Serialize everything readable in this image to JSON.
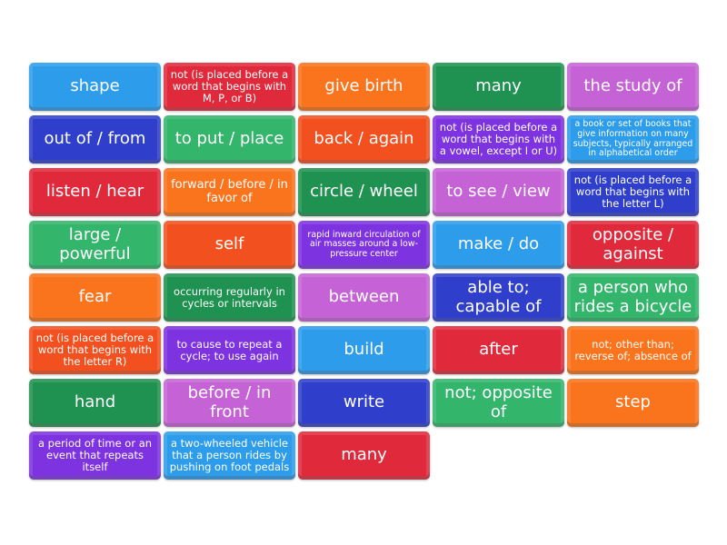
{
  "colors": {
    "blue": "#2d9ceb",
    "red": "#e02a3c",
    "orange": "#f9741c",
    "green": "#1f9150",
    "lightgreen": "#33b56c",
    "pink": "#c563d6",
    "darkblue": "#2f3fcc",
    "purple": "#7e33e0",
    "orangered": "#f2501f"
  },
  "tiles": [
    {
      "text": "shape",
      "color": "blue",
      "size": "l"
    },
    {
      "text": "not (is placed before a word that begins with M, P, or B)",
      "color": "red",
      "size": "s"
    },
    {
      "text": "give birth",
      "color": "orange",
      "size": "l"
    },
    {
      "text": "many",
      "color": "green",
      "size": "l"
    },
    {
      "text": "the study of",
      "color": "pink",
      "size": "l"
    },
    {
      "text": "out of / from",
      "color": "darkblue",
      "size": "l"
    },
    {
      "text": "to put / place",
      "color": "lightgreen",
      "size": "l"
    },
    {
      "text": "back / again",
      "color": "orangered",
      "size": "l"
    },
    {
      "text": "not (is placed before a word that begins with a vowel, except I or U)",
      "color": "purple",
      "size": "s"
    },
    {
      "text": "a book or set of books that give information on many subjects, typically arranged in alphabetical order",
      "color": "blue",
      "size": "xs"
    },
    {
      "text": "listen / hear",
      "color": "red",
      "size": "l"
    },
    {
      "text": "forward / before / in favor of",
      "color": "orange",
      "size": "m"
    },
    {
      "text": "circle / wheel",
      "color": "green",
      "size": "l"
    },
    {
      "text": "to see / view",
      "color": "pink",
      "size": "l"
    },
    {
      "text": "not (is placed before a word that begins with the letter L)",
      "color": "darkblue",
      "size": "s"
    },
    {
      "text": "large / powerful",
      "color": "lightgreen",
      "size": "l"
    },
    {
      "text": "self",
      "color": "orangered",
      "size": "l"
    },
    {
      "text": "rapid inward circulation of air masses around a low-pressure center",
      "color": "purple",
      "size": "xs"
    },
    {
      "text": "make / do",
      "color": "blue",
      "size": "l"
    },
    {
      "text": "opposite / against",
      "color": "red",
      "size": "l"
    },
    {
      "text": "fear",
      "color": "orange",
      "size": "l"
    },
    {
      "text": "occurring regularly in cycles or intervals",
      "color": "green",
      "size": "s"
    },
    {
      "text": "between",
      "color": "pink",
      "size": "l"
    },
    {
      "text": "able to; capable of",
      "color": "darkblue",
      "size": "l"
    },
    {
      "text": "a person who rides a bicycle",
      "color": "lightgreen",
      "size": "l"
    },
    {
      "text": "not (is placed before a word that begins with the letter R)",
      "color": "orangered",
      "size": "s"
    },
    {
      "text": "to cause to repeat a cycle; to use again",
      "color": "purple",
      "size": "s"
    },
    {
      "text": "build",
      "color": "blue",
      "size": "l"
    },
    {
      "text": "after",
      "color": "red",
      "size": "l"
    },
    {
      "text": "not; other than; reverse of; absence of",
      "color": "orange",
      "size": "s"
    },
    {
      "text": "hand",
      "color": "green",
      "size": "l"
    },
    {
      "text": "before / in front",
      "color": "pink",
      "size": "l"
    },
    {
      "text": "write",
      "color": "darkblue",
      "size": "l"
    },
    {
      "text": "not; opposite of",
      "color": "lightgreen",
      "size": "l"
    },
    {
      "text": "step",
      "color": "orange",
      "size": "l"
    },
    {
      "text": "a period of time or an event that repeats itself",
      "color": "purple",
      "size": "s"
    },
    {
      "text": "a two-wheeled vehicle that a person rides by pushing on foot pedals",
      "color": "blue",
      "size": "s"
    },
    {
      "text": "many",
      "color": "red",
      "size": "l"
    }
  ]
}
